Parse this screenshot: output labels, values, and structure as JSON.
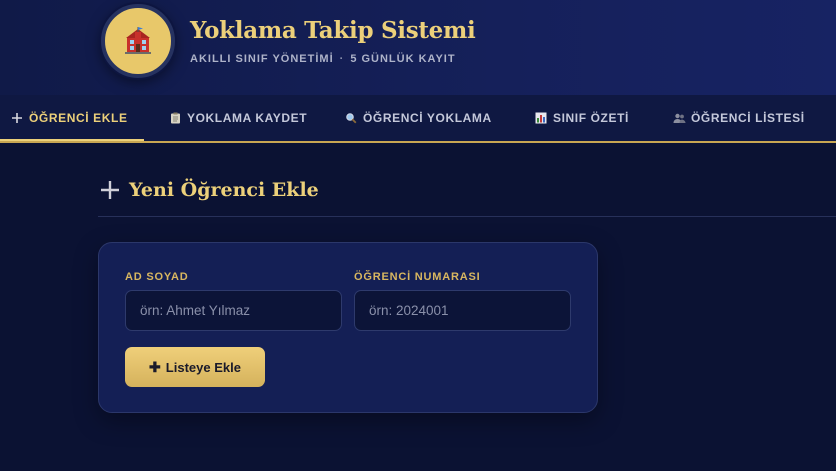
{
  "app": {
    "title": "Yoklama Takip Sistemi",
    "subtitle_left": "AKILLI SINIF YÖNETİMİ",
    "subtitle_sep": "·",
    "subtitle_right": "5 GÜNLÜK KAYIT",
    "logo_icon": "school-building-icon"
  },
  "nav": {
    "tabs": [
      {
        "label": "ÖĞRENCİ EKLE",
        "icon": "plus-icon",
        "active": true
      },
      {
        "label": "YOKLAMA KAYDET",
        "icon": "clipboard-icon",
        "active": false
      },
      {
        "label": "ÖĞRENCİ YOKLAMA",
        "icon": "magnifier-icon",
        "active": false
      },
      {
        "label": "SINIF ÖZETİ",
        "icon": "bar-chart-icon",
        "active": false
      },
      {
        "label": "ÖĞRENCİ LİSTESİ",
        "icon": "users-icon",
        "active": false
      }
    ]
  },
  "section": {
    "title": "Yeni Öğrenci Ekle"
  },
  "form": {
    "name_label": "AD SOYAD",
    "name_placeholder": "örn: Ahmet Yılmaz",
    "name_value": "",
    "number_label": "ÖĞRENCİ NUMARASI",
    "number_placeholder": "örn: 2024001",
    "number_value": "",
    "add_button": "Listeye Ekle"
  },
  "colors": {
    "accent_gold": "#ecd07a",
    "background": "#0b1233",
    "card": "#141f55"
  }
}
